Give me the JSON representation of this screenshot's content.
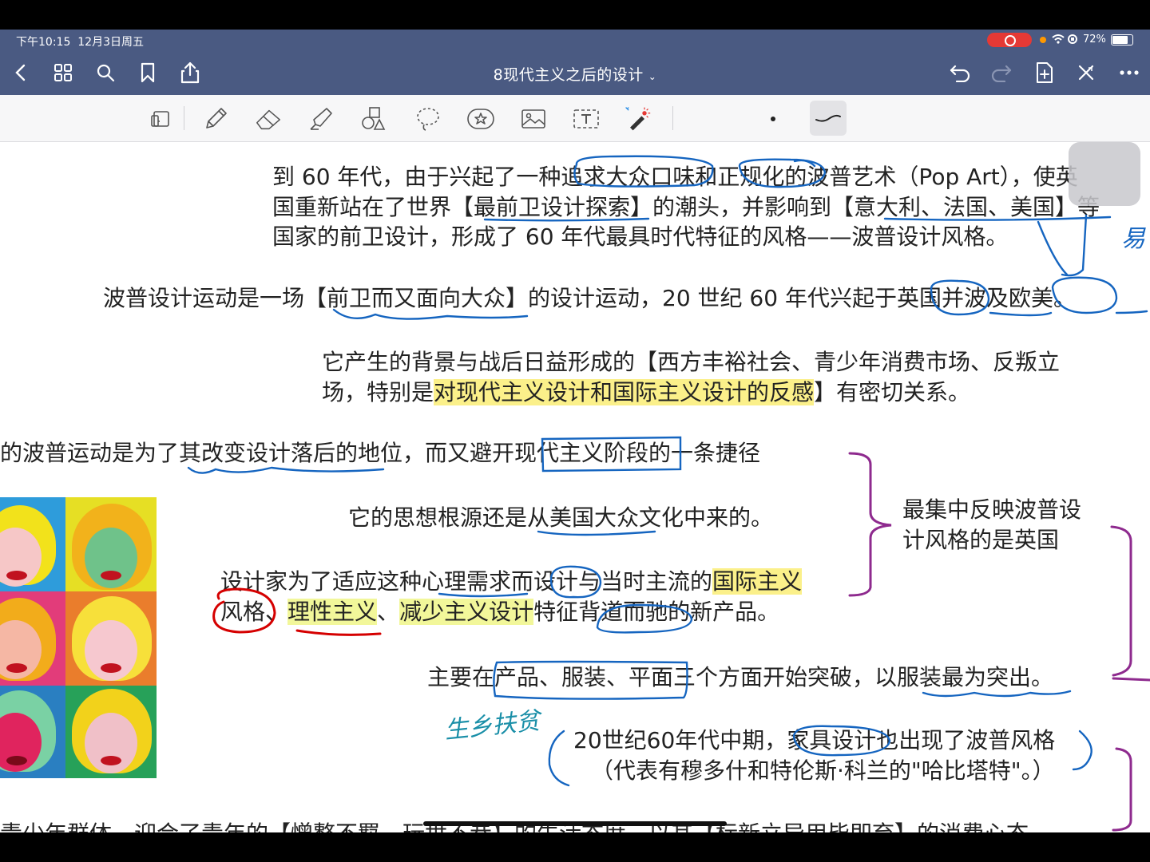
{
  "status": {
    "time": "下午10:15",
    "date": "12月3日周五",
    "battery": "72%",
    "battery_level": 0.72
  },
  "nav": {
    "title": "8现代主义之后的设计",
    "icons": [
      "back-icon",
      "grid-icon",
      "search-icon",
      "bookmark-icon",
      "share-icon",
      "undo-icon",
      "redo-icon",
      "add-page-icon",
      "close-icon",
      "more-icon"
    ]
  },
  "toolbar": {
    "tools": [
      "reader-icon",
      "pen-icon",
      "eraser-icon",
      "highlighter-icon",
      "shapes-icon",
      "lasso-icon",
      "sticker-icon",
      "image-icon",
      "text-icon",
      "laser-icon",
      "dot-size-icon",
      "stroke-style-icon"
    ]
  },
  "notes": {
    "p1_line1": "到 60 年代，由于兴起了一种追求大众口味和正规化的波普艺术（Pop Art），使英",
    "p1_line2": "国重新站在了世界【最前卫设计探索】的潮头，并影响到【意大利、法国、美国】等",
    "p1_line3": "国家的前卫设计，形成了 60 年代最具时代特征的风格——波普设计风格。",
    "p2": "波普设计运动是一场【前卫而又面向大众】的设计运动，20 世纪 60 年代兴起于英国并波及欧美。",
    "p3_line1": "它产生的背景与战后日益形成的【西方丰裕社会、青少年消费市场、反叛立",
    "p3_line2a": "场，特别是",
    "p3_line2b": "对现代主义设计和国际主义设计的反感",
    "p3_line2c": "】有密切关系。",
    "p4": "的波普运动是为了其改变设计落后的地位，而又避开现代主义阶段的一条捷径",
    "p5": "它的思想根源还是从美国大众文化中来的。",
    "p6_line1a": "设计家为了适应这种心理需求而设计与当时主流的",
    "p6_line1b": "国际主义",
    "p6_line2a": "风格",
    "p6_line2b": "、",
    "p6_line2c": "理性主义",
    "p6_line2d": "、",
    "p6_line2e": "减少主义设计",
    "p6_line2f": "特征背道而驰的新产品。",
    "p7": "主要在产品、服装、平面三个方面开始突破，以服装最为突出。",
    "p8_line1": "20世纪60年代中期，家具设计也出现了波普风格",
    "p8_line2": "（代表有穆多什和特伦斯·科兰的\"哈比塔特\"。）",
    "side_note_line1": "最集中反映波普设",
    "side_note_line2": "计风格的是英国",
    "p9": "青少年群体，迎合了青年的【憎整不羁、玩世不恭】的生活态度，以其【标新立异用毕即弃】的消费心态"
  },
  "handwriting": {
    "note_left": "生乡扶贫",
    "note_right": "易"
  },
  "colors": {
    "nav_bg": "#4a5a82",
    "ink_blue": "#1565c0",
    "ink_purple": "#8e2a8e",
    "ink_red": "#d50000",
    "highlight_yellow": "#fbf08a"
  }
}
